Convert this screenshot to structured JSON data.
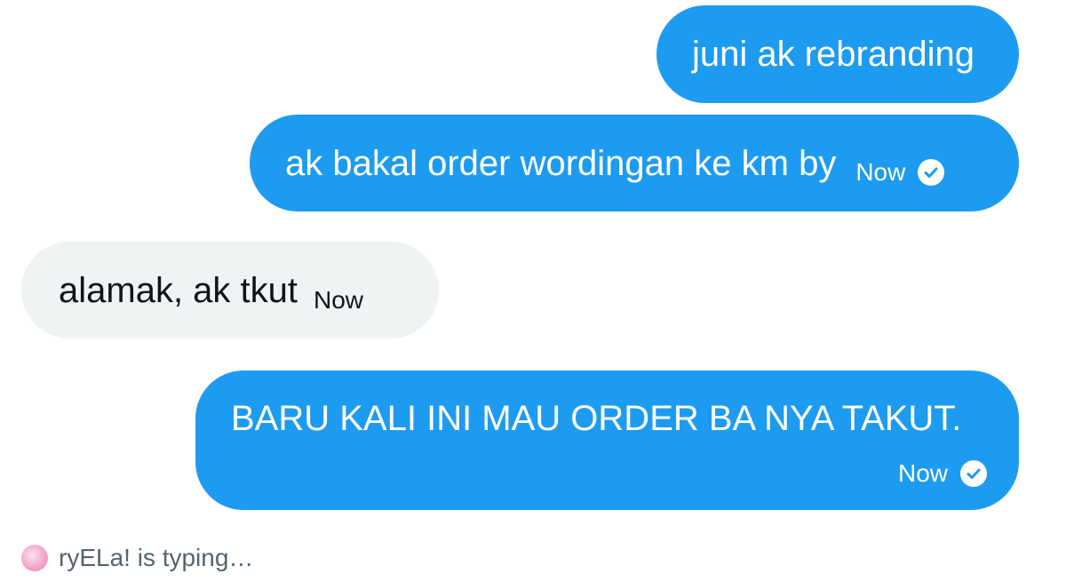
{
  "messages": [
    {
      "text": "juni ak rebranding",
      "direction": "sent",
      "time": "",
      "read": false
    },
    {
      "text": "ak bakal order wordingan ke km by",
      "direction": "sent",
      "time": "Now",
      "read": true
    },
    {
      "text": "alamak, ak tkut",
      "direction": "received",
      "time": "Now",
      "read": false
    },
    {
      "text": "BARU KALI INI MAU ORDER BA NYA TAKUT.",
      "direction": "sent",
      "time": "Now",
      "read": true
    }
  ],
  "typing": {
    "text": "ryELa! is typing…"
  },
  "colors": {
    "sent_bubble": "#1d9bf0",
    "received_bubble": "#eff3f4",
    "typing_text": "#536471"
  },
  "icons": {
    "read_status": "check-circle-icon",
    "avatar": "avatar"
  }
}
